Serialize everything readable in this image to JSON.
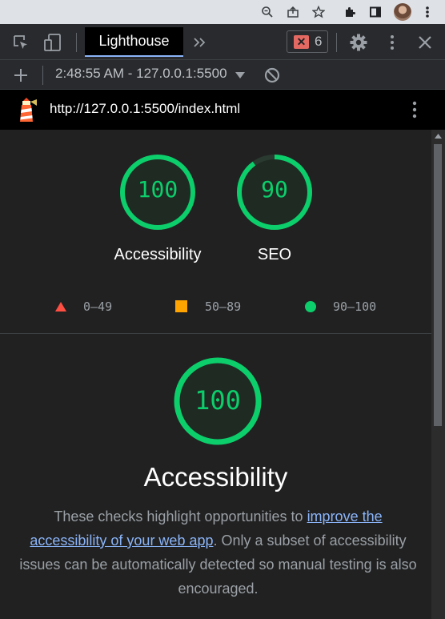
{
  "devtools": {
    "active_tab": "Lighthouse",
    "error_count": "6"
  },
  "report_selector": {
    "value": "2:48:55 AM - 127.0.0.1:5500"
  },
  "url_bar": {
    "url": "http://127.0.0.1:5500/index.html"
  },
  "gauges": [
    {
      "label": "Accessibility",
      "score": "100",
      "fraction": 1.0
    },
    {
      "label": "SEO",
      "score": "90",
      "fraction": 0.9
    }
  ],
  "legend": [
    {
      "range": "0–49",
      "color": "#ff4e42",
      "shape": "triangle"
    },
    {
      "range": "50–89",
      "color": "#ffa400",
      "shape": "square"
    },
    {
      "range": "90–100",
      "color": "#0cce6b",
      "shape": "circle"
    }
  ],
  "category": {
    "score": "100",
    "fraction": 1.0,
    "title": "Accessibility",
    "description_before": "These checks highlight opportunities to ",
    "link_text": "improve the accessibility of your web app",
    "description_after": ". Only a subset of accessibility issues can be automatically detected so manual testing is also encouraged."
  },
  "colors": {
    "pass": "#0cce6b",
    "link": "#8ab4f8",
    "toolbar_bg": "#292a2d",
    "content_bg": "#212121"
  }
}
